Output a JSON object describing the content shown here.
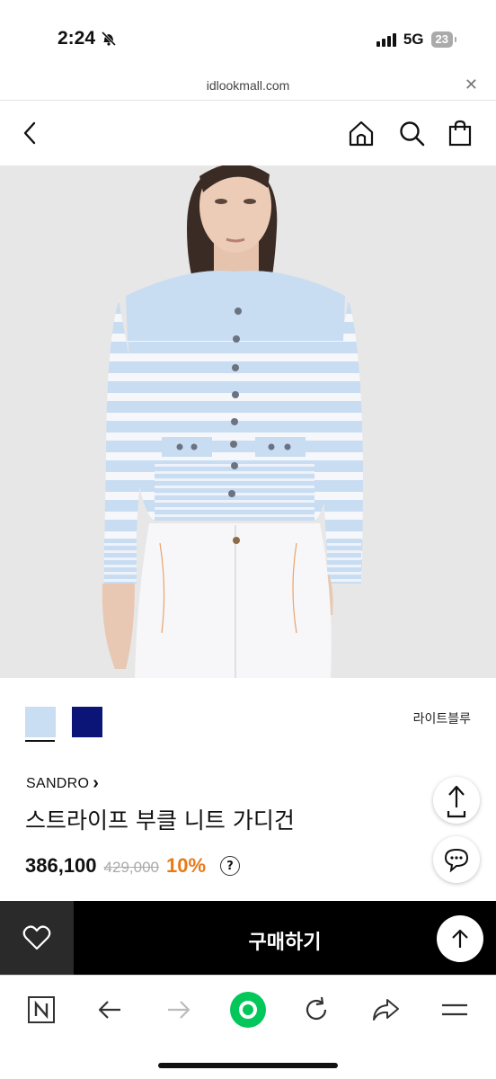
{
  "status": {
    "time": "2:24",
    "network": "5G",
    "battery": "23"
  },
  "browser": {
    "url": "idlookmall.com",
    "close_glyph": "✕"
  },
  "header": {
    "icons": [
      "back-icon",
      "home-icon",
      "search-icon",
      "shopping-bag-icon"
    ]
  },
  "product": {
    "swatch_colors": [
      "#c9ddf3",
      "#0b1578"
    ],
    "color_name": "라이트블루",
    "brand": "SANDRO",
    "brand_chevron": "›",
    "name": "스트라이프 부클 니트 가디건",
    "sale_price": "386,100",
    "original_price": "429,000",
    "discount": "10%",
    "help": "?"
  },
  "buy_bar": {
    "buy_label": "구매하기"
  },
  "colors": {
    "accent_discount": "#e87a17",
    "naver_green": "#03c75a"
  }
}
